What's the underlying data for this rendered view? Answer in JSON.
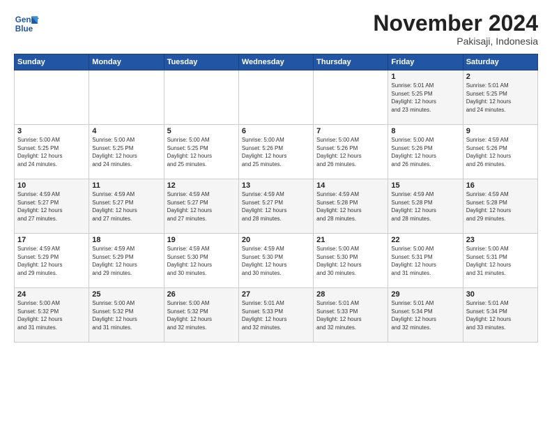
{
  "logo": {
    "text_line1": "General",
    "text_line2": "Blue"
  },
  "header": {
    "month_title": "November 2024",
    "subtitle": "Pakisaji, Indonesia"
  },
  "weekdays": [
    "Sunday",
    "Monday",
    "Tuesday",
    "Wednesday",
    "Thursday",
    "Friday",
    "Saturday"
  ],
  "weeks": [
    [
      {
        "day": "",
        "info": ""
      },
      {
        "day": "",
        "info": ""
      },
      {
        "day": "",
        "info": ""
      },
      {
        "day": "",
        "info": ""
      },
      {
        "day": "",
        "info": ""
      },
      {
        "day": "1",
        "info": "Sunrise: 5:01 AM\nSunset: 5:25 PM\nDaylight: 12 hours\nand 23 minutes."
      },
      {
        "day": "2",
        "info": "Sunrise: 5:01 AM\nSunset: 5:25 PM\nDaylight: 12 hours\nand 24 minutes."
      }
    ],
    [
      {
        "day": "3",
        "info": "Sunrise: 5:00 AM\nSunset: 5:25 PM\nDaylight: 12 hours\nand 24 minutes."
      },
      {
        "day": "4",
        "info": "Sunrise: 5:00 AM\nSunset: 5:25 PM\nDaylight: 12 hours\nand 24 minutes."
      },
      {
        "day": "5",
        "info": "Sunrise: 5:00 AM\nSunset: 5:25 PM\nDaylight: 12 hours\nand 25 minutes."
      },
      {
        "day": "6",
        "info": "Sunrise: 5:00 AM\nSunset: 5:26 PM\nDaylight: 12 hours\nand 25 minutes."
      },
      {
        "day": "7",
        "info": "Sunrise: 5:00 AM\nSunset: 5:26 PM\nDaylight: 12 hours\nand 26 minutes."
      },
      {
        "day": "8",
        "info": "Sunrise: 5:00 AM\nSunset: 5:26 PM\nDaylight: 12 hours\nand 26 minutes."
      },
      {
        "day": "9",
        "info": "Sunrise: 4:59 AM\nSunset: 5:26 PM\nDaylight: 12 hours\nand 26 minutes."
      }
    ],
    [
      {
        "day": "10",
        "info": "Sunrise: 4:59 AM\nSunset: 5:27 PM\nDaylight: 12 hours\nand 27 minutes."
      },
      {
        "day": "11",
        "info": "Sunrise: 4:59 AM\nSunset: 5:27 PM\nDaylight: 12 hours\nand 27 minutes."
      },
      {
        "day": "12",
        "info": "Sunrise: 4:59 AM\nSunset: 5:27 PM\nDaylight: 12 hours\nand 27 minutes."
      },
      {
        "day": "13",
        "info": "Sunrise: 4:59 AM\nSunset: 5:27 PM\nDaylight: 12 hours\nand 28 minutes."
      },
      {
        "day": "14",
        "info": "Sunrise: 4:59 AM\nSunset: 5:28 PM\nDaylight: 12 hours\nand 28 minutes."
      },
      {
        "day": "15",
        "info": "Sunrise: 4:59 AM\nSunset: 5:28 PM\nDaylight: 12 hours\nand 28 minutes."
      },
      {
        "day": "16",
        "info": "Sunrise: 4:59 AM\nSunset: 5:28 PM\nDaylight: 12 hours\nand 29 minutes."
      }
    ],
    [
      {
        "day": "17",
        "info": "Sunrise: 4:59 AM\nSunset: 5:29 PM\nDaylight: 12 hours\nand 29 minutes."
      },
      {
        "day": "18",
        "info": "Sunrise: 4:59 AM\nSunset: 5:29 PM\nDaylight: 12 hours\nand 29 minutes."
      },
      {
        "day": "19",
        "info": "Sunrise: 4:59 AM\nSunset: 5:30 PM\nDaylight: 12 hours\nand 30 minutes."
      },
      {
        "day": "20",
        "info": "Sunrise: 4:59 AM\nSunset: 5:30 PM\nDaylight: 12 hours\nand 30 minutes."
      },
      {
        "day": "21",
        "info": "Sunrise: 5:00 AM\nSunset: 5:30 PM\nDaylight: 12 hours\nand 30 minutes."
      },
      {
        "day": "22",
        "info": "Sunrise: 5:00 AM\nSunset: 5:31 PM\nDaylight: 12 hours\nand 31 minutes."
      },
      {
        "day": "23",
        "info": "Sunrise: 5:00 AM\nSunset: 5:31 PM\nDaylight: 12 hours\nand 31 minutes."
      }
    ],
    [
      {
        "day": "24",
        "info": "Sunrise: 5:00 AM\nSunset: 5:32 PM\nDaylight: 12 hours\nand 31 minutes."
      },
      {
        "day": "25",
        "info": "Sunrise: 5:00 AM\nSunset: 5:32 PM\nDaylight: 12 hours\nand 31 minutes."
      },
      {
        "day": "26",
        "info": "Sunrise: 5:00 AM\nSunset: 5:32 PM\nDaylight: 12 hours\nand 32 minutes."
      },
      {
        "day": "27",
        "info": "Sunrise: 5:01 AM\nSunset: 5:33 PM\nDaylight: 12 hours\nand 32 minutes."
      },
      {
        "day": "28",
        "info": "Sunrise: 5:01 AM\nSunset: 5:33 PM\nDaylight: 12 hours\nand 32 minutes."
      },
      {
        "day": "29",
        "info": "Sunrise: 5:01 AM\nSunset: 5:34 PM\nDaylight: 12 hours\nand 32 minutes."
      },
      {
        "day": "30",
        "info": "Sunrise: 5:01 AM\nSunset: 5:34 PM\nDaylight: 12 hours\nand 33 minutes."
      }
    ]
  ]
}
